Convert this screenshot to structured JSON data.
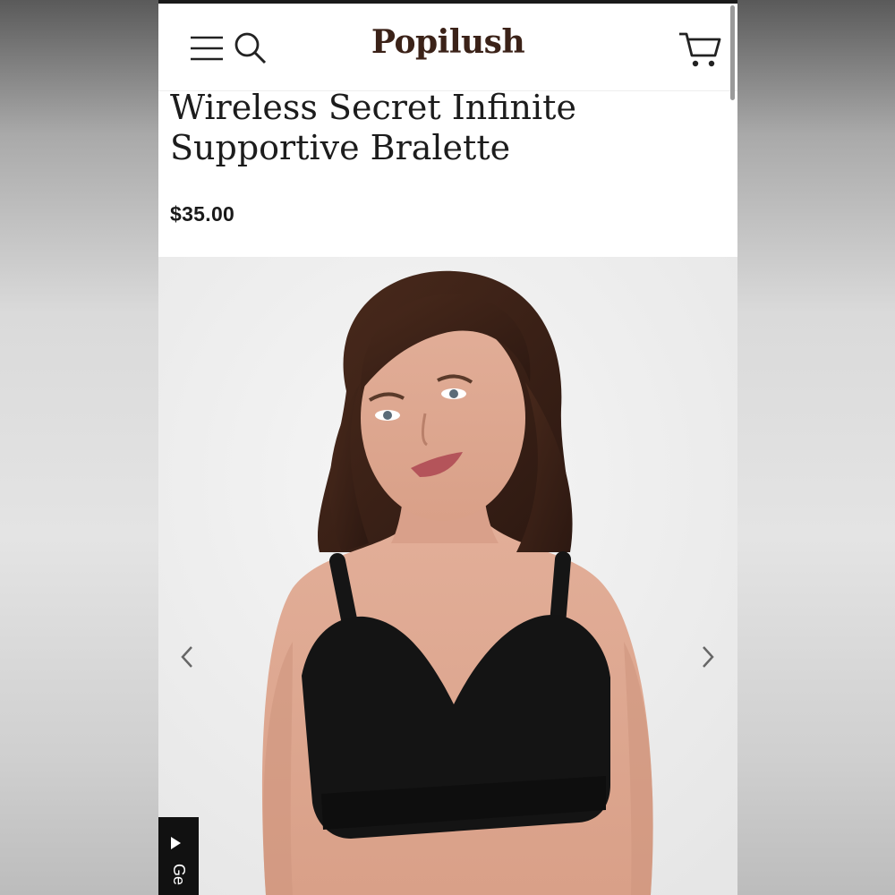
{
  "brand": {
    "logo_text": "Popilush"
  },
  "header": {
    "menu_icon": "menu-icon",
    "search_icon": "search-icon",
    "cart_icon": "cart-icon"
  },
  "product": {
    "title": "Wireless Secret Infinite Supportive Bralette",
    "price": "$35.00"
  },
  "gallery": {
    "prev_icon": "chevron-left-icon",
    "next_icon": "chevron-right-icon"
  },
  "feedback_tab": {
    "label": "Ge"
  },
  "colors": {
    "logo": "#3b2218",
    "text": "#1c1c1c",
    "background": "#ffffff",
    "gallery_bg": "#efefef"
  }
}
